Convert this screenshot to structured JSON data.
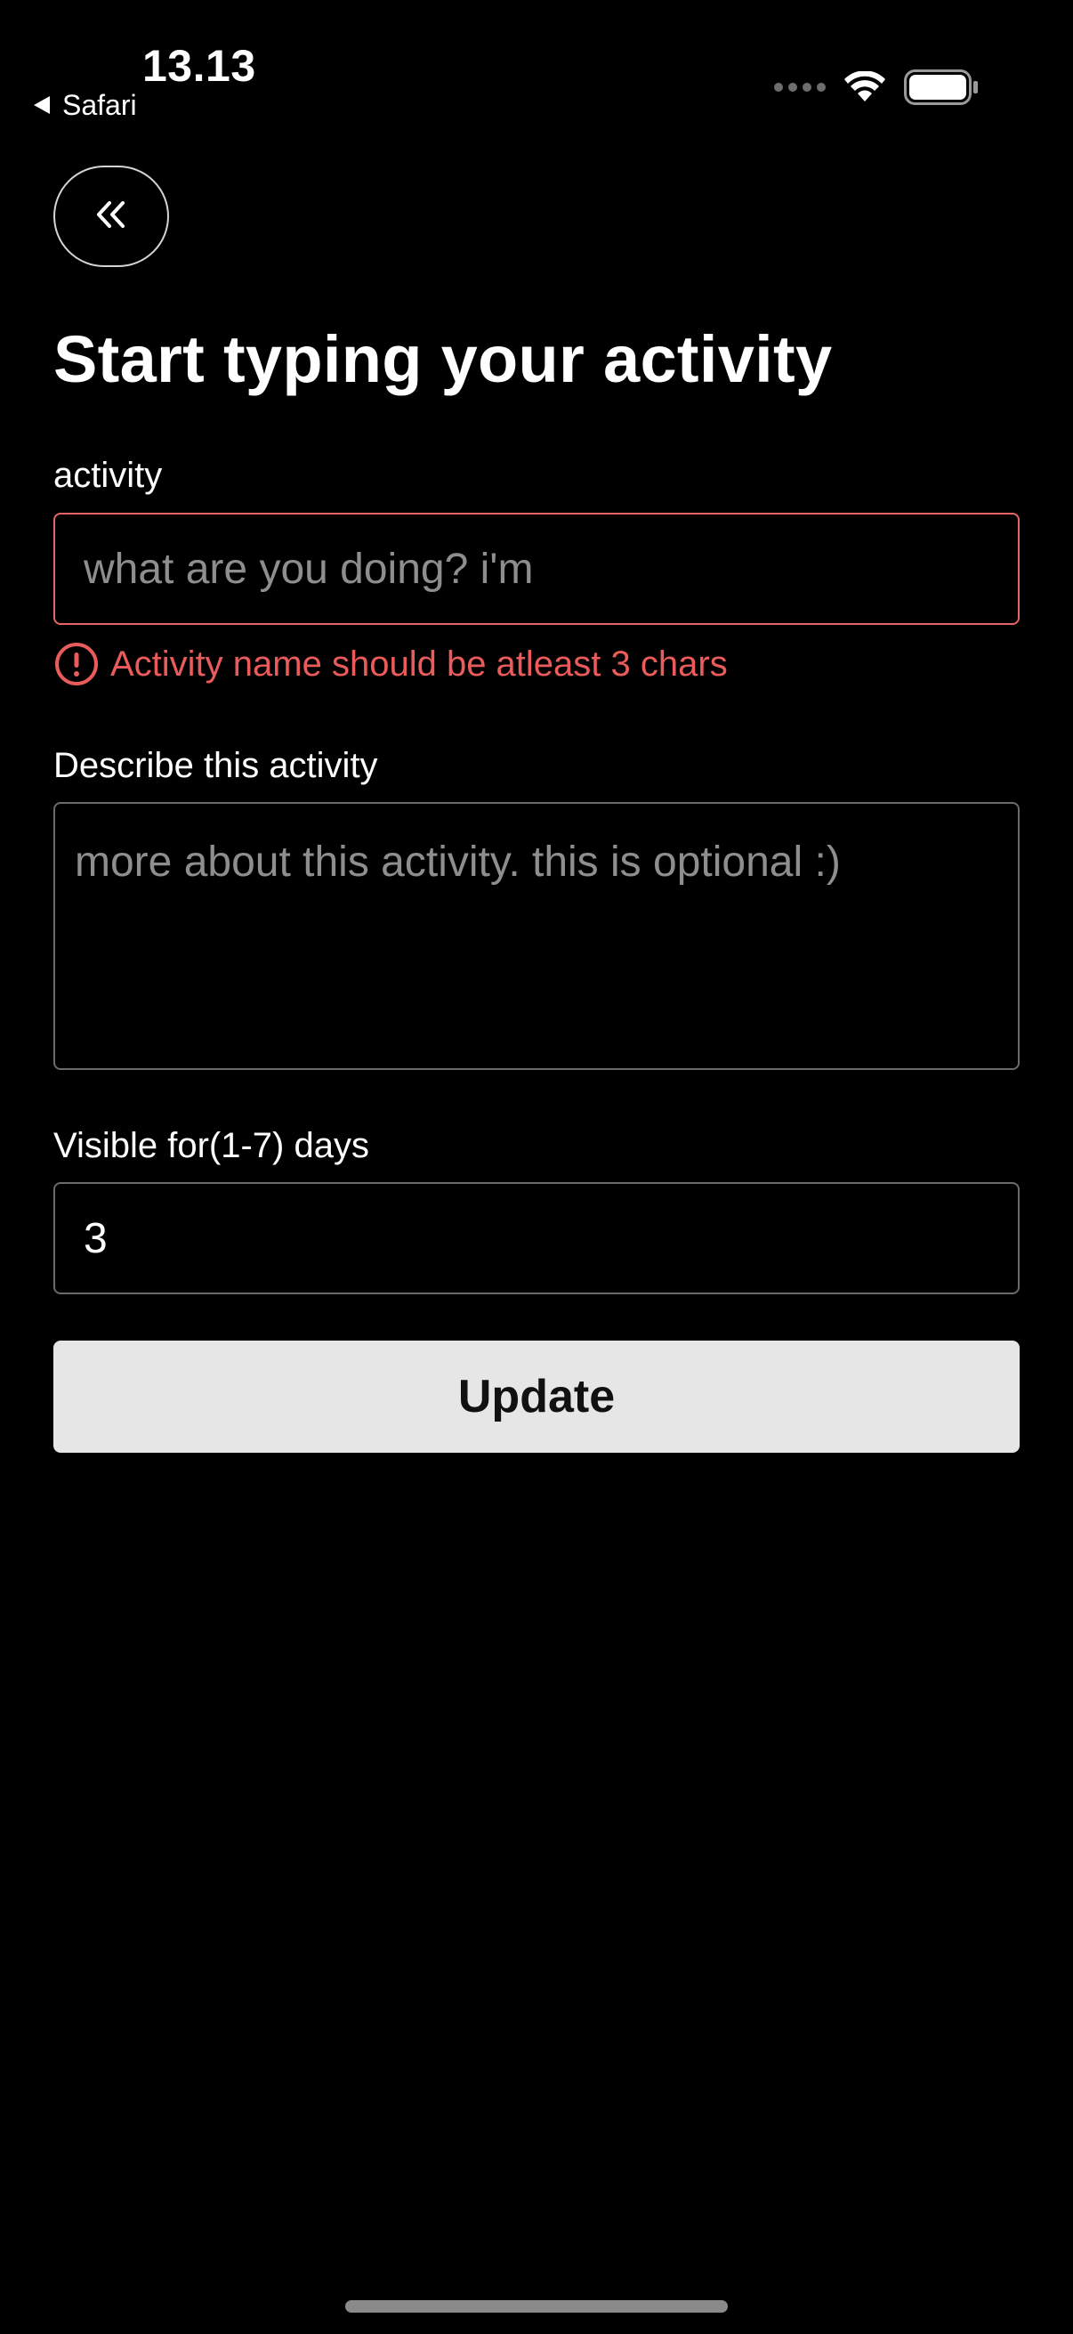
{
  "status_bar": {
    "time": "13.13",
    "back_app": "Safari",
    "icons": [
      "signal-dots-icon",
      "wifi-icon",
      "battery-icon"
    ]
  },
  "nav": {
    "back_icon": "double-chevron-left-icon"
  },
  "page": {
    "title": "Start typing your activity"
  },
  "form": {
    "activity": {
      "label": "activity",
      "value": "",
      "placeholder": "what are you doing? i'm",
      "error": "Activity name should be atleast 3 chars",
      "error_icon": "alert-circle-icon"
    },
    "description": {
      "label": "Describe this activity",
      "value": "",
      "placeholder": "more about this activity. this is optional :)"
    },
    "visible_days": {
      "label": "Visible for(1-7) days",
      "value": "3"
    },
    "submit_label": "Update"
  },
  "colors": {
    "background": "#000000",
    "error": "#ea5b5b",
    "error_border": "#e86565",
    "button_bg": "#e6e6e6"
  }
}
